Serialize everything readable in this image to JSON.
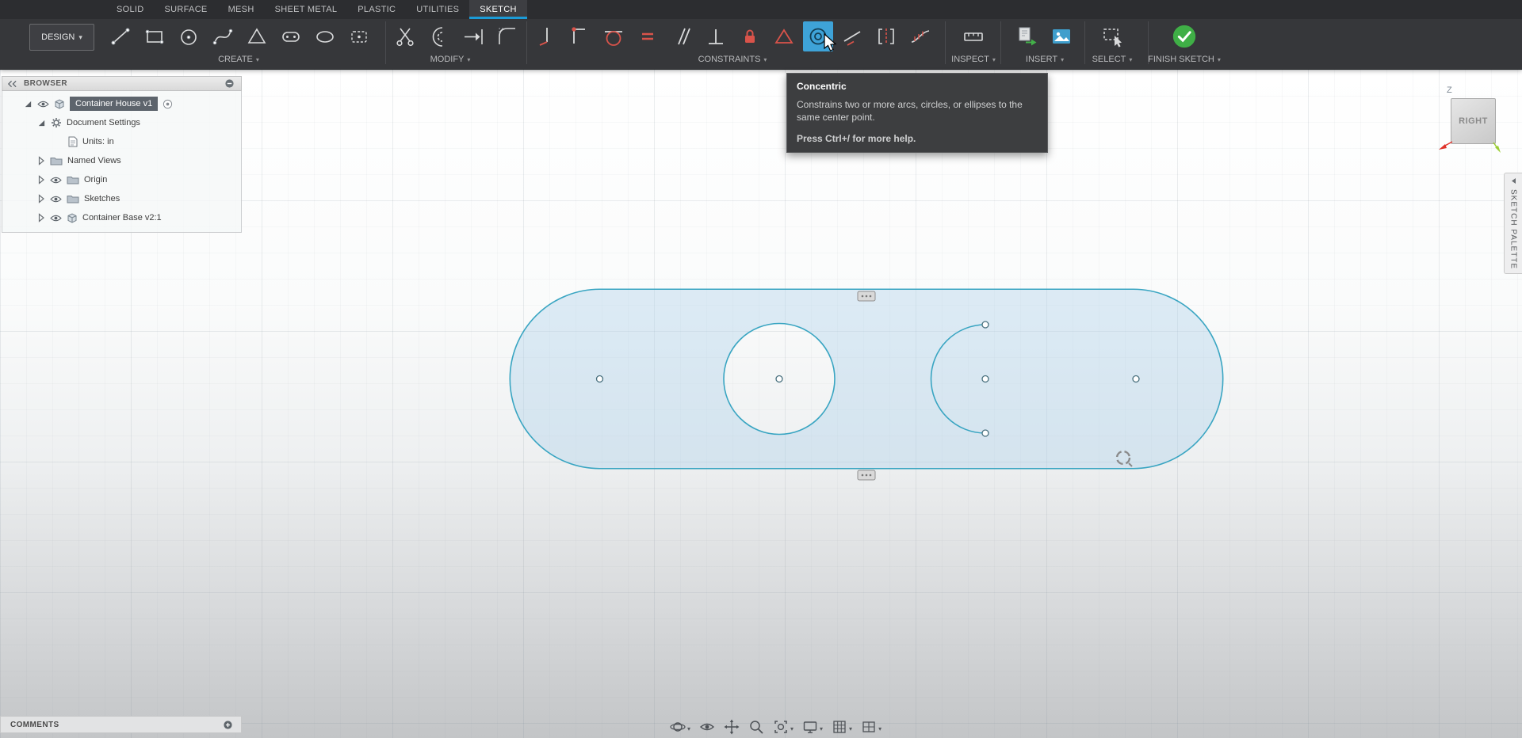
{
  "app": {
    "design_label": "DESIGN",
    "tabs": [
      {
        "label": "SOLID"
      },
      {
        "label": "SURFACE"
      },
      {
        "label": "MESH"
      },
      {
        "label": "SHEET METAL"
      },
      {
        "label": "PLASTIC"
      },
      {
        "label": "UTILITIES"
      },
      {
        "label": "SKETCH"
      }
    ],
    "active_tab": "SKETCH",
    "groups": {
      "create": "CREATE",
      "modify": "MODIFY",
      "constraints": "CONSTRAINTS",
      "inspect": "INSPECT",
      "insert": "INSERT",
      "select": "SELECT",
      "finish": "FINISH SKETCH"
    },
    "active_tool": "Concentric"
  },
  "tooltip": {
    "title": "Concentric",
    "body": "Constrains two or more arcs, circles, or ellipses to the same center point.",
    "help": "Press Ctrl+/ for more help."
  },
  "browser": {
    "title": "BROWSER",
    "items": [
      {
        "label": "Container House v1",
        "selected": true
      },
      {
        "label": "Document Settings"
      },
      {
        "label": "Units: in"
      },
      {
        "label": "Named Views"
      },
      {
        "label": "Origin"
      },
      {
        "label": "Sketches"
      },
      {
        "label": "Container Base v2:1"
      }
    ]
  },
  "viewcube": {
    "face": "RIGHT",
    "axis_z": "Z"
  },
  "right_panel": {
    "label": "SKETCH PALETTE"
  },
  "comments": {
    "label": "COMMENTS"
  },
  "colors": {
    "accent_blue": "#3ea3d8",
    "sketch_stroke": "#39a5c2",
    "selection_fill": "#aed2ea",
    "finish_green": "#3faf46",
    "constraint_red": "#d9534a"
  }
}
